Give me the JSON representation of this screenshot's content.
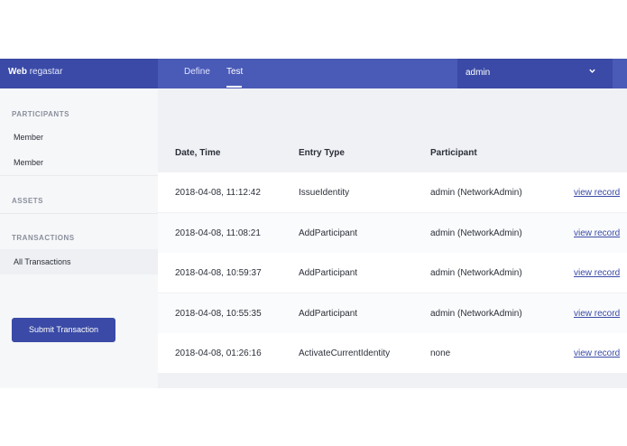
{
  "header": {
    "brand_bold": "Web",
    "brand_rest": "regastar",
    "tabs": [
      {
        "label": "Define"
      },
      {
        "label": "Test"
      }
    ],
    "user": "admin"
  },
  "sidebar": {
    "participants_heading": "PARTICIPANTS",
    "participants": [
      "Member",
      "Member"
    ],
    "assets_heading": "ASSETS",
    "transactions_heading": "TRANSACTIONS",
    "transactions_item": "All Transactions",
    "submit_label": "Submit Transaction"
  },
  "table": {
    "columns": [
      "Date, Time",
      "Entry Type",
      "Participant"
    ],
    "link_label": "view record",
    "rows": [
      {
        "datetime": "2018-04-08, 11:12:42",
        "entry_type": "IssueIdentity",
        "participant": "admin (NetworkAdmin)"
      },
      {
        "datetime": "2018-04-08, 11:08:21",
        "entry_type": "AddParticipant",
        "participant": "admin (NetworkAdmin)"
      },
      {
        "datetime": "2018-04-08, 10:59:37",
        "entry_type": "AddParticipant",
        "participant": "admin (NetworkAdmin)"
      },
      {
        "datetime": "2018-04-08, 10:55:35",
        "entry_type": "AddParticipant",
        "participant": "admin (NetworkAdmin)"
      },
      {
        "datetime": "2018-04-08, 01:26:16",
        "entry_type": "ActivateCurrentIdentity",
        "participant": "none"
      }
    ]
  }
}
